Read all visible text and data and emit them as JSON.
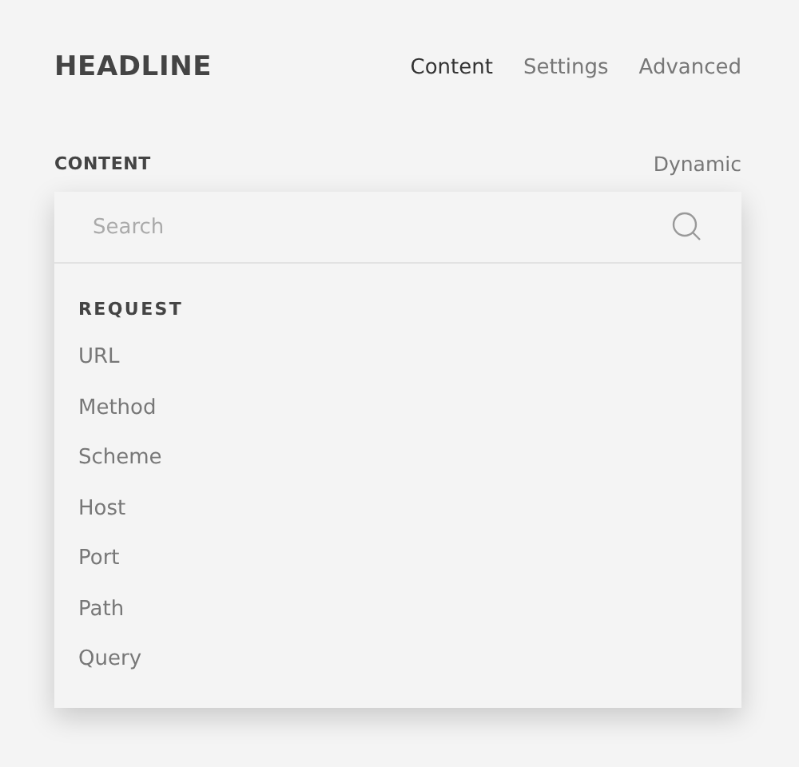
{
  "header": {
    "title": "HEADLINE",
    "tabs": [
      {
        "label": "Content",
        "selected": true
      },
      {
        "label": "Settings",
        "selected": false
      },
      {
        "label": "Advanced",
        "selected": false
      }
    ]
  },
  "field": {
    "label": "CONTENT",
    "mode": "Dynamic"
  },
  "dropdown": {
    "search": {
      "placeholder": "Search"
    },
    "sections": [
      {
        "heading": "REQUEST",
        "items": [
          "URL",
          "Method",
          "Scheme",
          "Host",
          "Port",
          "Path",
          "Query"
        ]
      }
    ]
  }
}
